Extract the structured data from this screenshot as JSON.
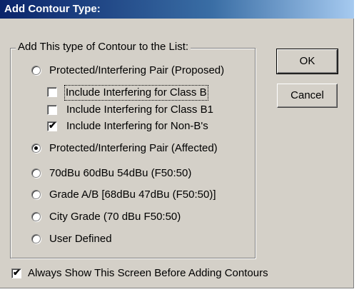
{
  "dialog": {
    "title": "Add Contour Type:",
    "group_label": "Add This type of Contour to the List:",
    "buttons": {
      "ok": "OK",
      "cancel": "Cancel"
    },
    "options": [
      {
        "label": "Protected/Interfering Pair (Proposed)",
        "selected": false
      },
      {
        "label": "Protected/Interfering Pair (Affected)",
        "selected": true
      },
      {
        "label": "70dBu 60dBu 54dBu (F50:50)",
        "selected": false
      },
      {
        "label": "Grade A/B [68dBu 47dBu (F50:50)]",
        "selected": false
      },
      {
        "label": "City Grade (70 dBu F50:50)",
        "selected": false
      },
      {
        "label": "User Defined",
        "selected": false
      }
    ],
    "sub_checks": [
      {
        "label": "Include Interfering for Class B",
        "checked": false
      },
      {
        "label": "Include Interfering for Class B1",
        "checked": false
      },
      {
        "label": "Include Interfering for Non-B's",
        "checked": true
      }
    ],
    "always_show": {
      "label": "Always Show This Screen Before Adding Contours",
      "checked": true
    }
  }
}
